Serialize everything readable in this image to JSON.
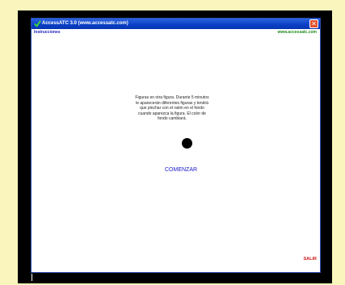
{
  "window": {
    "title": "AccessATC 3.0 (www.accessatc.com)",
    "close_glyph": "✕"
  },
  "menu": {
    "instructions": "Instrucciones",
    "website": "www.accessatc.com"
  },
  "main": {
    "description": "Figuras en otra figura. Durante 5 minutos le aparecerán diferentes figuras y tendrá que pinchar con el ratón en el fondo cuando aparezca la figura. El color de fondo cambiará.",
    "start_label": "COMENZAR",
    "exit_label": "SALIR"
  },
  "colors": {
    "page_background": "#f9f5bc",
    "titlebar": "#0a3fc4",
    "start_text": "#1818c8",
    "exit_text": "#d01818",
    "website_text": "#1c8a1c"
  },
  "icons": {
    "app": "green-check-icon",
    "close": "close-icon"
  }
}
